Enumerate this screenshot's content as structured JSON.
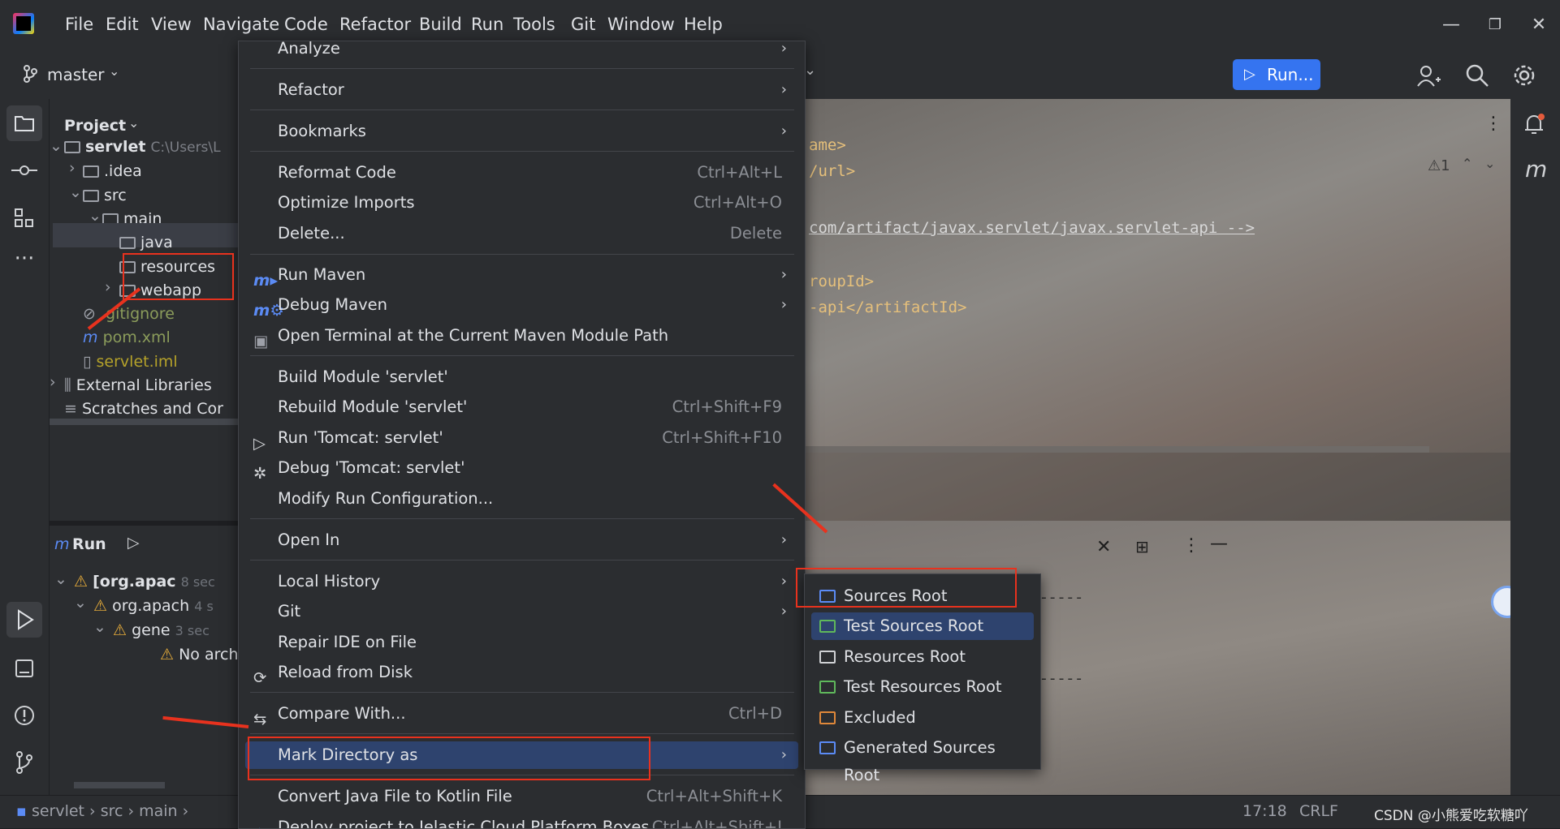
{
  "menubar": {
    "items": [
      "File",
      "Edit",
      "View",
      "Navigate",
      "Code",
      "Refactor",
      "Build",
      "Run",
      "Tools",
      "Git",
      "Window",
      "Help"
    ]
  },
  "toolbar": {
    "branch": "master",
    "run_label": "Run..."
  },
  "project": {
    "title": "Project",
    "root_name": "servlet",
    "root_path": "C:\\Users\\L",
    "items": {
      "idea": ".idea",
      "src": "src",
      "main": "main",
      "java": "java",
      "resources": "resources",
      "webapp": "webapp",
      "gitignore": ".gitignore",
      "pom": "pom.xml",
      "iml": "servlet.iml",
      "ext": "External Libraries",
      "scratch": "Scratches and Cor"
    }
  },
  "runpanel": {
    "title": "Run",
    "rows": {
      "r1": "[org.apac",
      "r1_time": "8 sec",
      "r2": "org.apach",
      "r2_time": "4 s",
      "r3": "gene",
      "r3_time": "3 sec",
      "r4": "No arch"
    }
  },
  "editor": {
    "lines": {
      "l1": "ame>",
      "l2": "/url>",
      "l3": "com/artifact/javax.servlet/javax.servlet-api -->",
      "l4": "roupId>",
      "l5": "-api</artifactId>"
    },
    "warning_count": "1"
  },
  "context_menu": {
    "analyze": "Analyze",
    "refactor": "Refactor",
    "bookmarks": "Bookmarks",
    "reformat": "Reformat Code",
    "reformat_sc": "Ctrl+Alt+L",
    "optimize": "Optimize Imports",
    "optimize_sc": "Ctrl+Alt+O",
    "delete": "Delete...",
    "delete_sc": "Delete",
    "run_maven": "Run Maven",
    "debug_maven": "Debug Maven",
    "open_terminal": "Open Terminal at the Current Maven Module Path",
    "build_module": "Build Module 'servlet'",
    "rebuild_module": "Rebuild Module 'servlet'",
    "rebuild_sc": "Ctrl+Shift+F9",
    "run_tomcat": "Run 'Tomcat: servlet'",
    "run_tomcat_sc": "Ctrl+Shift+F10",
    "debug_tomcat": "Debug 'Tomcat: servlet'",
    "modify_run": "Modify Run Configuration...",
    "open_in": "Open In",
    "local_history": "Local History",
    "git": "Git",
    "repair": "Repair IDE on File",
    "reload": "Reload from Disk",
    "compare": "Compare With...",
    "compare_sc": "Ctrl+D",
    "mark_dir": "Mark Directory as",
    "convert": "Convert Java File to Kotlin File",
    "convert_sc": "Ctrl+Alt+Shift+K",
    "deploy": "Deploy project to Jelastic Cloud Platform Boxes",
    "deploy_sc": "Ctrl+Alt+Shift+J"
  },
  "submenu": {
    "sources_root": "Sources Root",
    "test_sources_root": "Test Sources Root",
    "resources_root": "Resources Root",
    "test_resources_root": "Test Resources Root",
    "excluded": "Excluded",
    "generated_sources_root": "Generated Sources Root"
  },
  "statusbar": {
    "crumbs": [
      "servlet",
      "src",
      "main"
    ],
    "position": "17:18",
    "line_sep": "CRLF",
    "watermark": "CSDN @小熊爱吃软糖吖"
  },
  "colors": {
    "accent": "#3574f0",
    "selection": "#2e436e",
    "annotation": "#e8321e"
  }
}
